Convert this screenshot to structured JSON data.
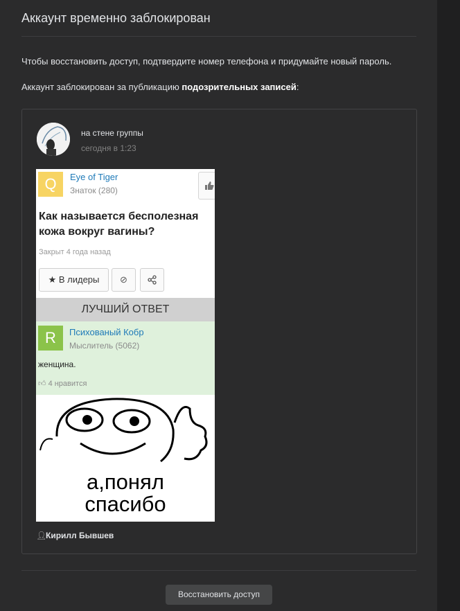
{
  "page": {
    "title": "Аккаунт временно заблокирован",
    "message": "Чтобы восстановить доступ, подтвердите номер телефона и придумайте новый пароль.",
    "reason_prefix": "Аккаунт заблокирован за публикацию ",
    "reason_bold": "подозрительных записей",
    "reason_suffix": ":"
  },
  "post": {
    "source": "на стене группы",
    "time": "сегодня в 1:23",
    "author": "Кирилл Бывшев",
    "author_icon": "person-icon",
    "image": {
      "question_badge": "Q",
      "question_user": "Eye of Tiger",
      "question_rank": "Знаток (280)",
      "question_text": "Как называется бесполезная кожа вокруг вагины?",
      "closed": "Закрыт 4 года назад",
      "leaders_button": "★ В лидеры",
      "best_answer": "ЛУЧШИЙ ОТВЕТ",
      "answer_badge": "R",
      "answer_user": "Психованый Кобр",
      "answer_rank": "Мыслитель (5062)",
      "answer_text": "женщина.",
      "answer_likes": "4 нравится",
      "meme_line1": "а,понял",
      "meme_line2": "спасибо"
    }
  },
  "actions": {
    "restore_label": "Восстановить доступ"
  },
  "colors": {
    "background": "#2b2b2c",
    "button": "#454647",
    "link": "#1e7ab8"
  }
}
